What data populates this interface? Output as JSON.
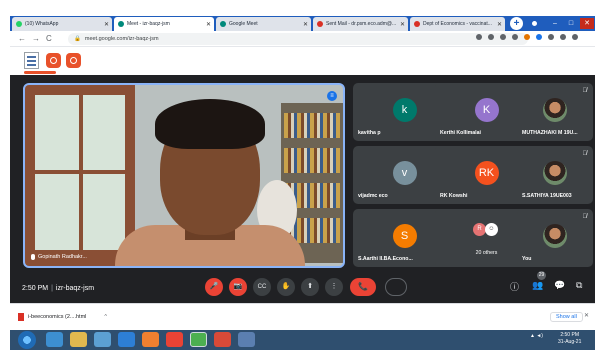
{
  "browser": {
    "tabs": [
      {
        "label": "(10) WhatsApp",
        "favicon_color": "#25d366"
      },
      {
        "label": "Meet - izr-baqz-jsm",
        "favicon_color": "#00897b"
      },
      {
        "label": "Google Meet",
        "favicon_color": "#00897b"
      },
      {
        "label": "Sent Mail - dr.psm.eco.adm@...",
        "favicon_color": "#d93025"
      },
      {
        "label": "Dept of Economics - vaccinat...",
        "favicon_color": "#d93025"
      }
    ],
    "url": "meet.google.com/izr-baqz-jsm",
    "nav": {
      "back": "←",
      "forward": "→",
      "reload": "C"
    },
    "new_tab": "+",
    "window_controls": {
      "minimize": "–",
      "maximize": "□",
      "close": "✕"
    }
  },
  "meet": {
    "main_speaker": "Gopinath Radhakr...",
    "participants": [
      {
        "name": "kavitha p",
        "initial": "k",
        "color": "#00796b"
      },
      {
        "name": "Kerthi Kollimalai",
        "initial": "K",
        "color": "#9575cd"
      },
      {
        "name": "MUTHAZHAKI M 19U...",
        "initial": "",
        "color": "photo"
      },
      {
        "name": "vijadmc eco",
        "initial": "v",
        "color": "#78909c"
      },
      {
        "name": "RK Kowshi",
        "initial": "RK",
        "color": "#f4511e"
      },
      {
        "name": "S.SATHIYA 19UE003",
        "initial": "",
        "color": "photo"
      },
      {
        "name": "S.Aarthi II.BA.Econo...",
        "initial": "S",
        "color": "#f57c00"
      },
      {
        "name": "20 others",
        "initial": "R",
        "color": "#e57373"
      },
      {
        "name": "You",
        "initial": "",
        "color": "photo"
      }
    ],
    "time": "2:50 PM",
    "meeting_code": "izr-baqz-jsm",
    "participant_count": "29",
    "controls": {
      "mic": "🎤",
      "cam": "📷",
      "captions": "CC",
      "hand": "✋",
      "present": "⬆",
      "more": "⋮",
      "end": "📞"
    },
    "right_controls": {
      "info": "ⓘ",
      "people": "👥",
      "chat": "💬",
      "activities": "⧉"
    }
  },
  "downloads": {
    "file": "i-beeconomics (2....html",
    "chevron": "^",
    "show_all": "Show all",
    "close": "✕"
  },
  "taskbar": {
    "time": "2:50 PM",
    "date": "31-Aug-21",
    "tray": "▲ ◄)"
  }
}
